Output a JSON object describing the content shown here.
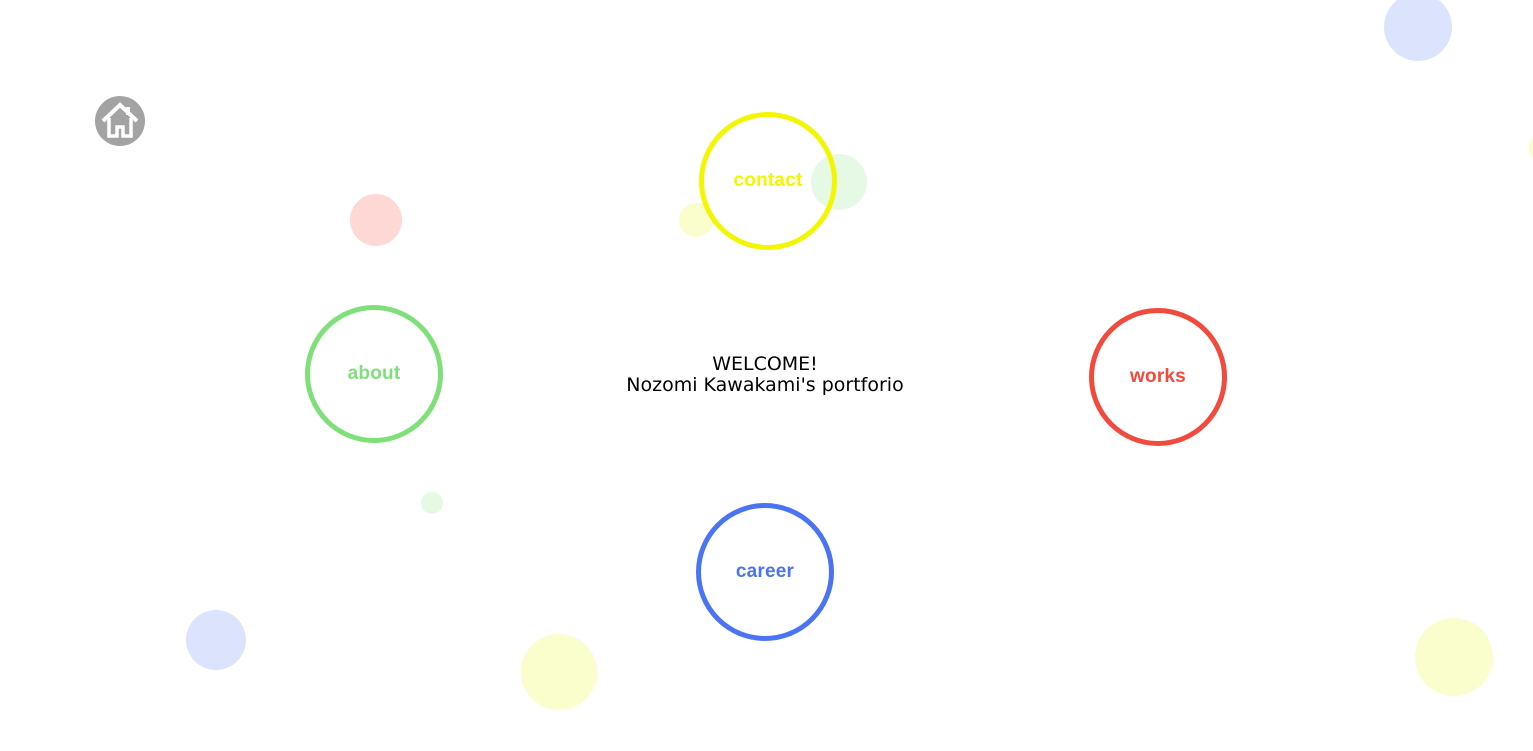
{
  "home": {
    "icon": "home-icon",
    "color": "#a3a3a3"
  },
  "welcome": {
    "line1": "WELCOME!",
    "line2": "Nozomi Kawakami's portforio"
  },
  "nav": {
    "contact": {
      "label": "contact",
      "color": "#f2f700"
    },
    "about": {
      "label": "about",
      "color": "#7fe07a"
    },
    "works": {
      "label": "works",
      "color": "#f24a3d"
    },
    "career": {
      "label": "career",
      "color": "#4a74f4"
    }
  },
  "decor_colors": {
    "blue": "#dbe4fc",
    "green": "#e6f9e5",
    "pink": "#fdd8d4",
    "yellow": "#fafdcc"
  }
}
